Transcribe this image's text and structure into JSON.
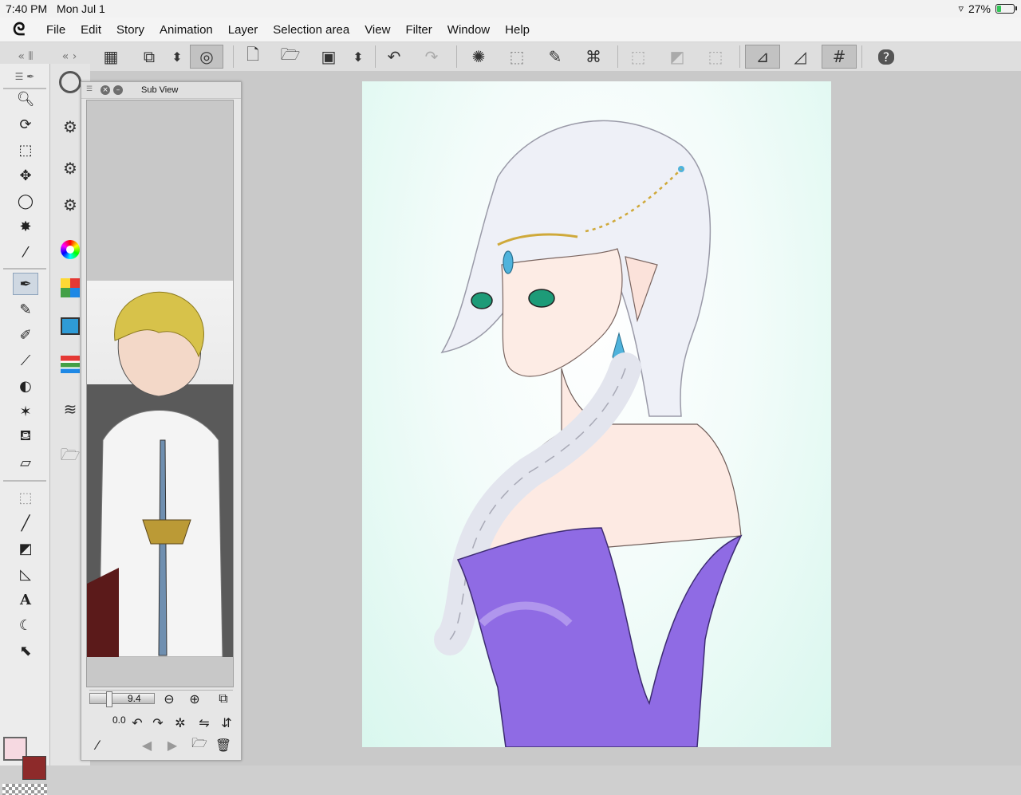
{
  "status_bar": {
    "time": "7:40 PM",
    "date": "Mon Jul 1",
    "battery": "27%",
    "battery_level": 0.27
  },
  "menu": {
    "items": [
      "File",
      "Edit",
      "Story",
      "Animation",
      "Layer",
      "Selection area",
      "View",
      "Filter",
      "Window",
      "Help"
    ]
  },
  "command_bar": {
    "icons": [
      "grid-icon",
      "settings-layers-icon",
      "up-down-icon",
      "lasso-icon",
      "new-file-icon",
      "open-folder-icon",
      "save-icon",
      "up-down-icon",
      "undo-icon",
      "redo-icon",
      "sparkle-icon",
      "transform-icon",
      "eraser-selection-icon",
      "crop-icon",
      "deselect-icon",
      "invert-selection-icon",
      "selection-border-icon",
      "snap-ruler-icon",
      "snap-special-ruler-icon",
      "snap-grid-icon",
      "help-icon"
    ]
  },
  "sub_view": {
    "title": "Sub View",
    "zoom": "9.4",
    "rotation": "0.0"
  },
  "colors": {
    "main": "#f6d9e1",
    "sub": "#8d2a2a",
    "canvas_bg": "#d9f7ee",
    "accent": "#8ea4bc"
  }
}
